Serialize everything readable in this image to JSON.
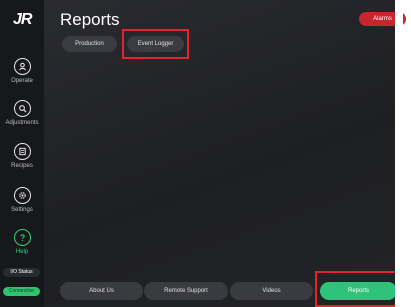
{
  "sidebar": {
    "logo": "JR",
    "items": [
      {
        "label": "Operate",
        "icon": "operate-icon"
      },
      {
        "label": "Adjustments",
        "icon": "adjustments-icon"
      },
      {
        "label": "Recipes",
        "icon": "recipes-icon"
      },
      {
        "label": "Settings",
        "icon": "settings-icon"
      },
      {
        "label": "Help",
        "icon": "help-icon"
      }
    ],
    "io_status": "I/O Status",
    "green_pill": "Connection"
  },
  "header": {
    "title": "Reports",
    "alarms_label": "Alarms"
  },
  "tabs": [
    {
      "label": "Production"
    },
    {
      "label": "Event Logger"
    }
  ],
  "bottom_bar": [
    {
      "label": "About Us"
    },
    {
      "label": "Remote Support"
    },
    {
      "label": "Videos"
    },
    {
      "label": "Reports"
    }
  ],
  "colors": {
    "accent": "#2fc27a",
    "alarm": "#c8252d",
    "highlight": "#e0252e"
  }
}
